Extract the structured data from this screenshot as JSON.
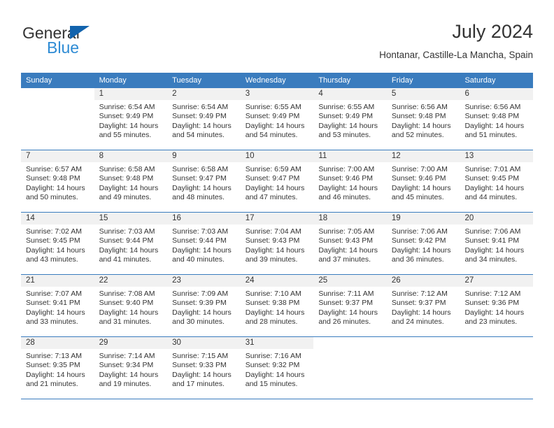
{
  "brand": {
    "name_dark": "General",
    "name_light": "Blue",
    "triangle_color": "#1263ad",
    "light_color": "#2e8bd4"
  },
  "header": {
    "title": "July 2024",
    "subtitle": "Hontanar, Castille-La Mancha, Spain",
    "header_bg": "#3a7cbe",
    "daynum_bg": "#f1f1f1"
  },
  "weekdays": [
    "Sunday",
    "Monday",
    "Tuesday",
    "Wednesday",
    "Thursday",
    "Friday",
    "Saturday"
  ],
  "labels": {
    "sunrise": "Sunrise:",
    "sunset": "Sunset:",
    "daylight": "Daylight:"
  },
  "weeks": [
    [
      {
        "day": "",
        "sunrise": "",
        "sunset": "",
        "daylight_1": "",
        "daylight_2": ""
      },
      {
        "day": "1",
        "sunrise": "Sunrise: 6:54 AM",
        "sunset": "Sunset: 9:49 PM",
        "daylight_1": "Daylight: 14 hours",
        "daylight_2": "and 55 minutes."
      },
      {
        "day": "2",
        "sunrise": "Sunrise: 6:54 AM",
        "sunset": "Sunset: 9:49 PM",
        "daylight_1": "Daylight: 14 hours",
        "daylight_2": "and 54 minutes."
      },
      {
        "day": "3",
        "sunrise": "Sunrise: 6:55 AM",
        "sunset": "Sunset: 9:49 PM",
        "daylight_1": "Daylight: 14 hours",
        "daylight_2": "and 54 minutes."
      },
      {
        "day": "4",
        "sunrise": "Sunrise: 6:55 AM",
        "sunset": "Sunset: 9:49 PM",
        "daylight_1": "Daylight: 14 hours",
        "daylight_2": "and 53 minutes."
      },
      {
        "day": "5",
        "sunrise": "Sunrise: 6:56 AM",
        "sunset": "Sunset: 9:48 PM",
        "daylight_1": "Daylight: 14 hours",
        "daylight_2": "and 52 minutes."
      },
      {
        "day": "6",
        "sunrise": "Sunrise: 6:56 AM",
        "sunset": "Sunset: 9:48 PM",
        "daylight_1": "Daylight: 14 hours",
        "daylight_2": "and 51 minutes."
      }
    ],
    [
      {
        "day": "7",
        "sunrise": "Sunrise: 6:57 AM",
        "sunset": "Sunset: 9:48 PM",
        "daylight_1": "Daylight: 14 hours",
        "daylight_2": "and 50 minutes."
      },
      {
        "day": "8",
        "sunrise": "Sunrise: 6:58 AM",
        "sunset": "Sunset: 9:48 PM",
        "daylight_1": "Daylight: 14 hours",
        "daylight_2": "and 49 minutes."
      },
      {
        "day": "9",
        "sunrise": "Sunrise: 6:58 AM",
        "sunset": "Sunset: 9:47 PM",
        "daylight_1": "Daylight: 14 hours",
        "daylight_2": "and 48 minutes."
      },
      {
        "day": "10",
        "sunrise": "Sunrise: 6:59 AM",
        "sunset": "Sunset: 9:47 PM",
        "daylight_1": "Daylight: 14 hours",
        "daylight_2": "and 47 minutes."
      },
      {
        "day": "11",
        "sunrise": "Sunrise: 7:00 AM",
        "sunset": "Sunset: 9:46 PM",
        "daylight_1": "Daylight: 14 hours",
        "daylight_2": "and 46 minutes."
      },
      {
        "day": "12",
        "sunrise": "Sunrise: 7:00 AM",
        "sunset": "Sunset: 9:46 PM",
        "daylight_1": "Daylight: 14 hours",
        "daylight_2": "and 45 minutes."
      },
      {
        "day": "13",
        "sunrise": "Sunrise: 7:01 AM",
        "sunset": "Sunset: 9:45 PM",
        "daylight_1": "Daylight: 14 hours",
        "daylight_2": "and 44 minutes."
      }
    ],
    [
      {
        "day": "14",
        "sunrise": "Sunrise: 7:02 AM",
        "sunset": "Sunset: 9:45 PM",
        "daylight_1": "Daylight: 14 hours",
        "daylight_2": "and 43 minutes."
      },
      {
        "day": "15",
        "sunrise": "Sunrise: 7:03 AM",
        "sunset": "Sunset: 9:44 PM",
        "daylight_1": "Daylight: 14 hours",
        "daylight_2": "and 41 minutes."
      },
      {
        "day": "16",
        "sunrise": "Sunrise: 7:03 AM",
        "sunset": "Sunset: 9:44 PM",
        "daylight_1": "Daylight: 14 hours",
        "daylight_2": "and 40 minutes."
      },
      {
        "day": "17",
        "sunrise": "Sunrise: 7:04 AM",
        "sunset": "Sunset: 9:43 PM",
        "daylight_1": "Daylight: 14 hours",
        "daylight_2": "and 39 minutes."
      },
      {
        "day": "18",
        "sunrise": "Sunrise: 7:05 AM",
        "sunset": "Sunset: 9:43 PM",
        "daylight_1": "Daylight: 14 hours",
        "daylight_2": "and 37 minutes."
      },
      {
        "day": "19",
        "sunrise": "Sunrise: 7:06 AM",
        "sunset": "Sunset: 9:42 PM",
        "daylight_1": "Daylight: 14 hours",
        "daylight_2": "and 36 minutes."
      },
      {
        "day": "20",
        "sunrise": "Sunrise: 7:06 AM",
        "sunset": "Sunset: 9:41 PM",
        "daylight_1": "Daylight: 14 hours",
        "daylight_2": "and 34 minutes."
      }
    ],
    [
      {
        "day": "21",
        "sunrise": "Sunrise: 7:07 AM",
        "sunset": "Sunset: 9:41 PM",
        "daylight_1": "Daylight: 14 hours",
        "daylight_2": "and 33 minutes."
      },
      {
        "day": "22",
        "sunrise": "Sunrise: 7:08 AM",
        "sunset": "Sunset: 9:40 PM",
        "daylight_1": "Daylight: 14 hours",
        "daylight_2": "and 31 minutes."
      },
      {
        "day": "23",
        "sunrise": "Sunrise: 7:09 AM",
        "sunset": "Sunset: 9:39 PM",
        "daylight_1": "Daylight: 14 hours",
        "daylight_2": "and 30 minutes."
      },
      {
        "day": "24",
        "sunrise": "Sunrise: 7:10 AM",
        "sunset": "Sunset: 9:38 PM",
        "daylight_1": "Daylight: 14 hours",
        "daylight_2": "and 28 minutes."
      },
      {
        "day": "25",
        "sunrise": "Sunrise: 7:11 AM",
        "sunset": "Sunset: 9:37 PM",
        "daylight_1": "Daylight: 14 hours",
        "daylight_2": "and 26 minutes."
      },
      {
        "day": "26",
        "sunrise": "Sunrise: 7:12 AM",
        "sunset": "Sunset: 9:37 PM",
        "daylight_1": "Daylight: 14 hours",
        "daylight_2": "and 24 minutes."
      },
      {
        "day": "27",
        "sunrise": "Sunrise: 7:12 AM",
        "sunset": "Sunset: 9:36 PM",
        "daylight_1": "Daylight: 14 hours",
        "daylight_2": "and 23 minutes."
      }
    ],
    [
      {
        "day": "28",
        "sunrise": "Sunrise: 7:13 AM",
        "sunset": "Sunset: 9:35 PM",
        "daylight_1": "Daylight: 14 hours",
        "daylight_2": "and 21 minutes."
      },
      {
        "day": "29",
        "sunrise": "Sunrise: 7:14 AM",
        "sunset": "Sunset: 9:34 PM",
        "daylight_1": "Daylight: 14 hours",
        "daylight_2": "and 19 minutes."
      },
      {
        "day": "30",
        "sunrise": "Sunrise: 7:15 AM",
        "sunset": "Sunset: 9:33 PM",
        "daylight_1": "Daylight: 14 hours",
        "daylight_2": "and 17 minutes."
      },
      {
        "day": "31",
        "sunrise": "Sunrise: 7:16 AM",
        "sunset": "Sunset: 9:32 PM",
        "daylight_1": "Daylight: 14 hours",
        "daylight_2": "and 15 minutes."
      },
      {
        "day": "",
        "sunrise": "",
        "sunset": "",
        "daylight_1": "",
        "daylight_2": ""
      },
      {
        "day": "",
        "sunrise": "",
        "sunset": "",
        "daylight_1": "",
        "daylight_2": ""
      },
      {
        "day": "",
        "sunrise": "",
        "sunset": "",
        "daylight_1": "",
        "daylight_2": ""
      }
    ]
  ]
}
